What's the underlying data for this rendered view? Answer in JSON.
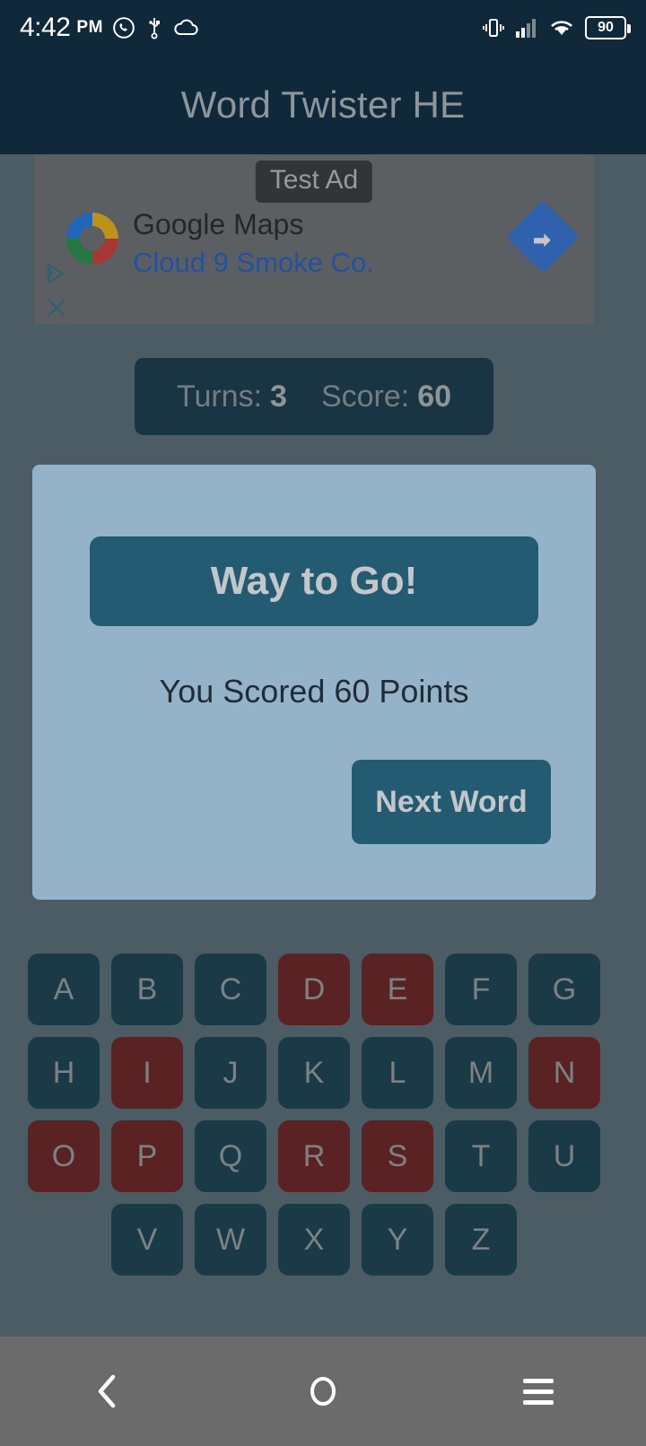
{
  "status_bar": {
    "time": "4:42",
    "ampm": "PM",
    "battery_percent": "90",
    "left_icons": [
      "whatsapp-icon",
      "usb-icon",
      "cloud-icon"
    ],
    "right_icons": [
      "vibrate-icon",
      "signal-icon",
      "wifi-icon",
      "battery-icon"
    ]
  },
  "app_bar": {
    "title": "Word Twister HE"
  },
  "ad": {
    "test_label": "Test Ad",
    "headline": "Google Maps",
    "advertiser": "Cloud 9 Smoke Co.",
    "logo_icon": "google-logo-icon",
    "cta_icon": "navigation-arrow-icon",
    "adchoices_icon": "adchoices-icon",
    "close_icon": "close-icon",
    "background_color": "#6a6a6a"
  },
  "score_bar": {
    "turns_label": "Turns:",
    "turns_value": "3",
    "score_label": "Score:",
    "score_value": "60",
    "background_color": "#0c2f3e"
  },
  "dialog": {
    "title": "Way to Go!",
    "message": "You Scored 60 Points",
    "next_button_label": "Next Word",
    "background_color": "#bde3fc",
    "accent_color": "#1a6682"
  },
  "keyboard": {
    "key_color": "#0d3646",
    "used_key_color": "#6b1410",
    "rows": [
      [
        {
          "letter": "A",
          "used": false
        },
        {
          "letter": "B",
          "used": false
        },
        {
          "letter": "C",
          "used": false
        },
        {
          "letter": "D",
          "used": true
        },
        {
          "letter": "E",
          "used": true
        },
        {
          "letter": "F",
          "used": false
        },
        {
          "letter": "G",
          "used": false
        }
      ],
      [
        {
          "letter": "H",
          "used": false
        },
        {
          "letter": "I",
          "used": true
        },
        {
          "letter": "J",
          "used": false
        },
        {
          "letter": "K",
          "used": false
        },
        {
          "letter": "L",
          "used": false
        },
        {
          "letter": "M",
          "used": false
        },
        {
          "letter": "N",
          "used": true
        }
      ],
      [
        {
          "letter": "O",
          "used": true
        },
        {
          "letter": "P",
          "used": true
        },
        {
          "letter": "Q",
          "used": false
        },
        {
          "letter": "R",
          "used": true
        },
        {
          "letter": "S",
          "used": true
        },
        {
          "letter": "T",
          "used": false
        },
        {
          "letter": "U",
          "used": false
        }
      ],
      [
        {
          "letter": "V",
          "used": false
        },
        {
          "letter": "W",
          "used": false
        },
        {
          "letter": "X",
          "used": false
        },
        {
          "letter": "Y",
          "used": false
        },
        {
          "letter": "Z",
          "used": false
        }
      ]
    ]
  },
  "nav_bar": {
    "back_icon": "back-chevron-icon",
    "home_icon": "home-circle-icon",
    "recents_icon": "menu-hamburger-icon",
    "background_color": "#6b6b6b"
  }
}
